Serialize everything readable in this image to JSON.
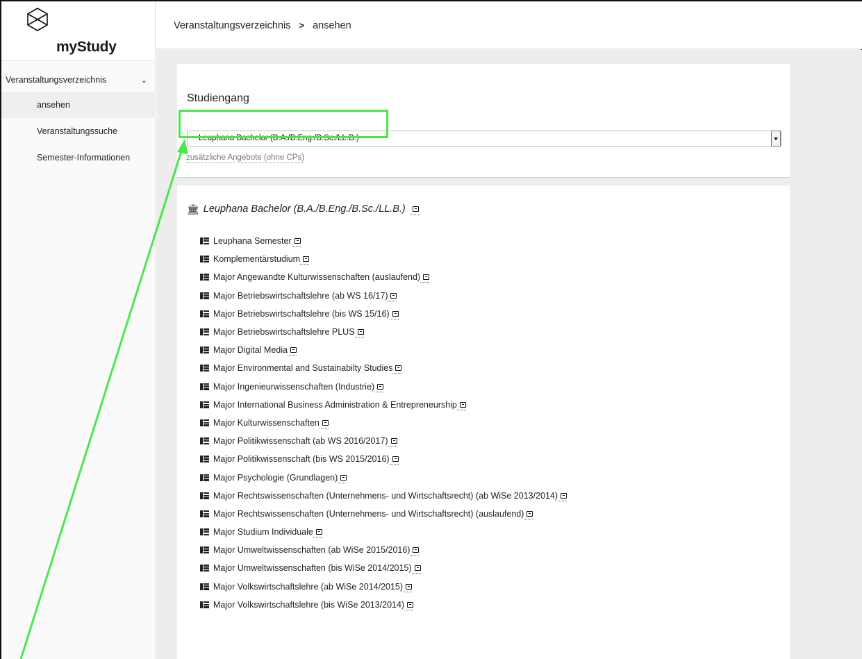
{
  "app": {
    "logo_text": "myStudy"
  },
  "header": {
    "breadcrumb": [
      "Veranstaltungsverzeichnis",
      "ansehen"
    ],
    "separator": ">"
  },
  "sidebar": {
    "group_label": "Veranstaltungsverzeichnis",
    "items": [
      {
        "label": "ansehen"
      },
      {
        "label": "Veranstaltungssuche"
      },
      {
        "label": "Semester-Informationen"
      }
    ]
  },
  "filter": {
    "title": "Studiengang",
    "selected": "Leuphana Bachelor (B.A./B.Eng./B.Sc./LL.B.)",
    "extra_link": "zusätzliche Angebote (ohne CPs)"
  },
  "tree": {
    "root": "Leuphana Bachelor (B.A./B.Eng./B.Sc./LL.B.)",
    "items": [
      "Leuphana Semester",
      "Komplementärstudium",
      "Major Angewandte Kulturwissenschaften (auslaufend)",
      "Major Betriebswirtschaftslehre (ab WS 16/17)",
      "Major Betriebswirtschaftslehre (bis WS 15/16)",
      "Major Betriebswirtschaftslehre PLUS",
      "Major Digital Media",
      "Major Environmental and Sustainabilty Studies",
      "Major Ingenieurwissenschaften (Industrie)",
      "Major International Business Administration & Entrepreneurship",
      "Major Kulturwissenschaften",
      "Major Politikwissenschaft (ab WS 2016/2017)",
      "Major Politikwissenschaft (bis WS 2015/2016)",
      "Major Psychologie (Grundlagen)",
      "Major Rechtswissenschaften (Unternehmens- und Wirtschaftsrecht) (ab WiSe 2013/2014)",
      "Major Rechtswissenschaften (Unternehmens- und Wirtschaftsrecht) (auslaufend)",
      "Major Studium Individuale",
      "Major Umweltwissenschaften (ab WiSe 2015/2016)",
      "Major Umweltwissenschaften (bis WiSe 2014/2015)",
      "Major Volkswirtschaftslehre (ab WiSe 2014/2015)",
      "Major Volkswirtschaftslehre (bis WiSe 2013/2014)"
    ]
  },
  "colors": {
    "annotation": "#4ce64c",
    "content_bg": "#ededed"
  },
  "icons": {
    "logo": "cube-icon",
    "root": "institution-icon",
    "item": "list-icon",
    "external": "external-link-icon",
    "nav_toggle": "chevron-down-icon"
  }
}
